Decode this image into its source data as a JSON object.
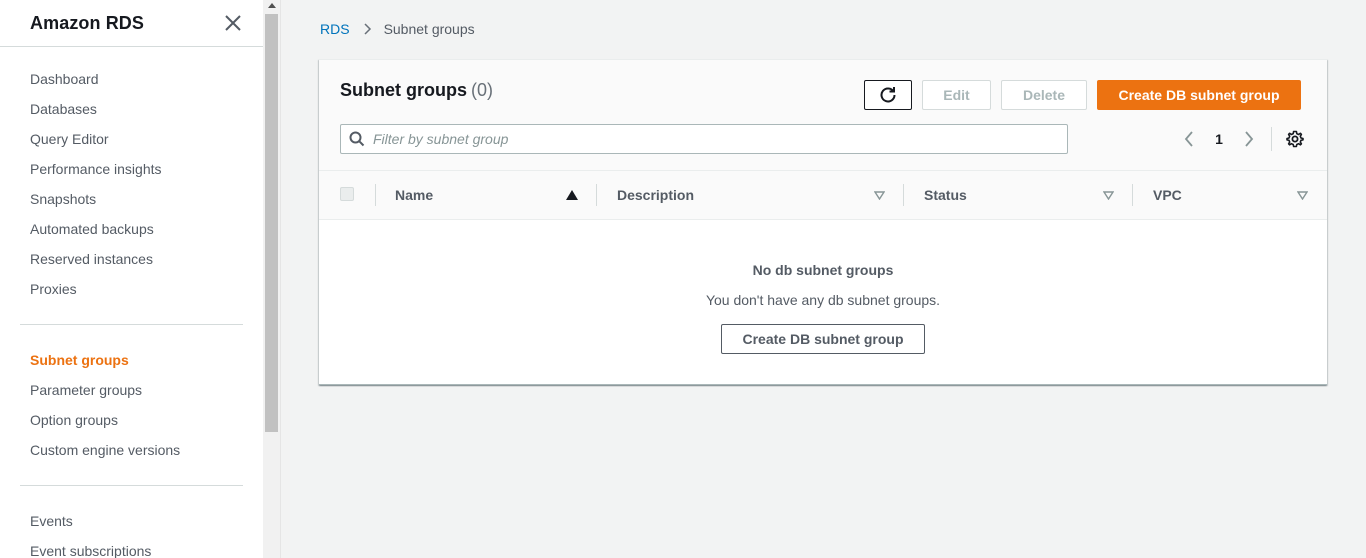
{
  "sidebar": {
    "title": "Amazon RDS",
    "group1": [
      {
        "label": "Dashboard"
      },
      {
        "label": "Databases"
      },
      {
        "label": "Query Editor"
      },
      {
        "label": "Performance insights"
      },
      {
        "label": "Snapshots"
      },
      {
        "label": "Automated backups"
      },
      {
        "label": "Reserved instances"
      },
      {
        "label": "Proxies"
      }
    ],
    "group2": [
      {
        "label": "Subnet groups",
        "active": true
      },
      {
        "label": "Parameter groups"
      },
      {
        "label": "Option groups"
      },
      {
        "label": "Custom engine versions"
      }
    ],
    "group3": [
      {
        "label": "Events"
      },
      {
        "label": "Event subscriptions"
      }
    ]
  },
  "breadcrumb": {
    "root": "RDS",
    "current": "Subnet groups"
  },
  "panel": {
    "title": "Subnet groups",
    "count": "(0)",
    "edit_label": "Edit",
    "delete_label": "Delete",
    "create_label": "Create DB subnet group",
    "search_placeholder": "Filter by subnet group",
    "page_number": "1"
  },
  "table": {
    "columns": [
      {
        "label": "Name",
        "sort": "ascending"
      },
      {
        "label": "Description",
        "sort": "none"
      },
      {
        "label": "Status",
        "sort": "none"
      },
      {
        "label": "VPC",
        "sort": "none"
      }
    ],
    "rows": []
  },
  "empty_state": {
    "title": "No db subnet groups",
    "text": "You don't have any db subnet groups.",
    "button_label": "Create DB subnet group"
  },
  "colors": {
    "accent": "#ec7211",
    "link": "#0073bb",
    "text_secondary": "#545b64"
  },
  "icons": {
    "close": "close-icon",
    "refresh": "refresh-icon",
    "search": "search-icon",
    "settings": "gear-icon"
  }
}
